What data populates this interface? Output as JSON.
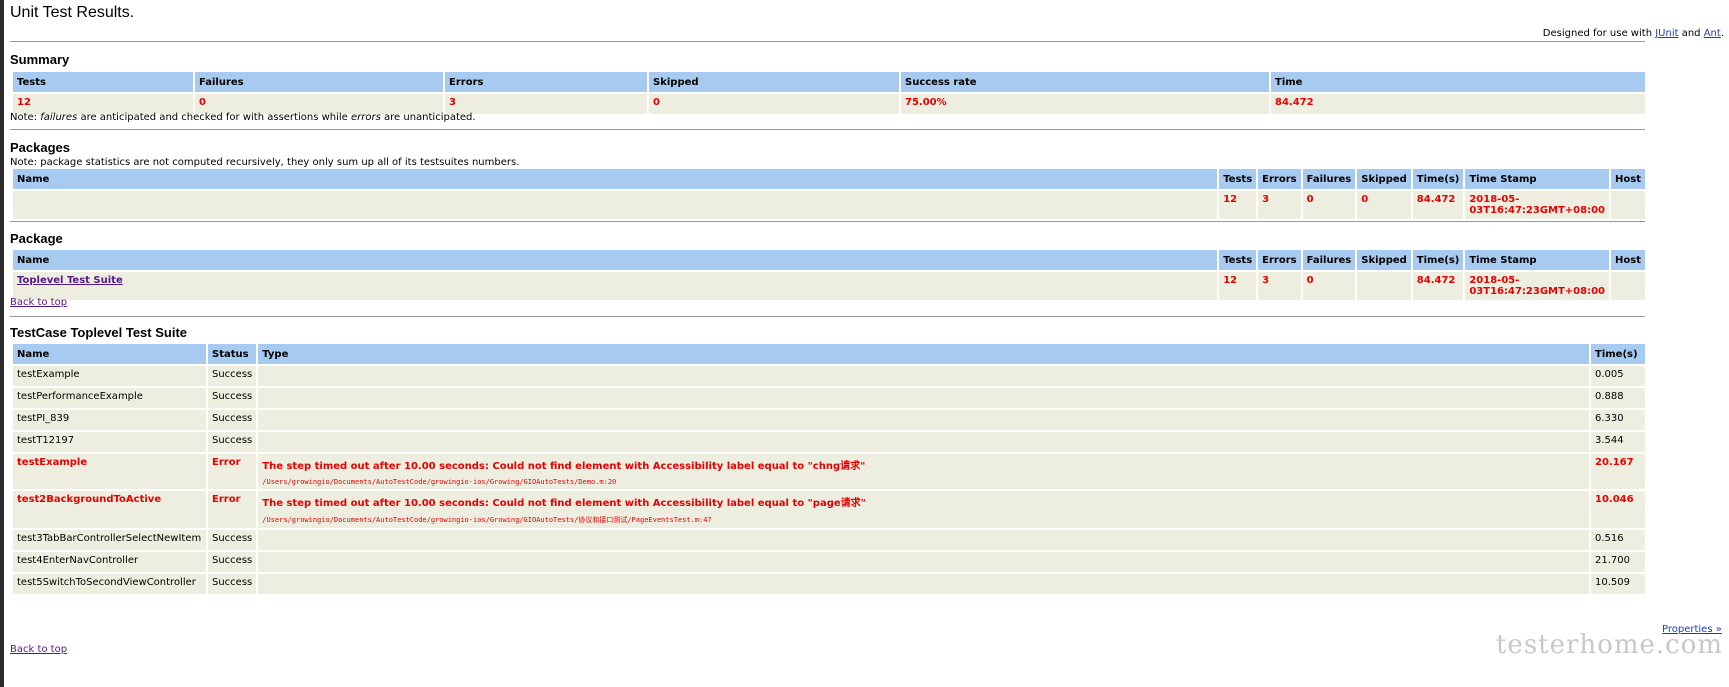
{
  "title": "Unit Test Results.",
  "designed": {
    "prefix": "Designed for use with ",
    "junit": "JUnit",
    "and": " and ",
    "ant": "Ant",
    "suffix": "."
  },
  "summary": {
    "heading": "Summary",
    "headers": [
      "Tests",
      "Failures",
      "Errors",
      "Skipped",
      "Success rate",
      "Time"
    ],
    "values": [
      "12",
      "0",
      "3",
      "0",
      "75.00%",
      "84.472"
    ],
    "note_prefix": "Note: ",
    "note_failures": "failures",
    "note_mid": " are anticipated and checked for with assertions while ",
    "note_errors": "errors",
    "note_suffix": " are unanticipated."
  },
  "packages": {
    "heading": "Packages",
    "note": "Note: package statistics are not computed recursively, they only sum up all of its testsuites numbers.",
    "headers": [
      "Name",
      "Tests",
      "Errors",
      "Failures",
      "Skipped",
      "Time(s)",
      "Time Stamp",
      "Host"
    ],
    "row": [
      "",
      "12",
      "3",
      "0",
      "0",
      "84.472",
      "2018-05-03T16:47:23GMT+08:00",
      ""
    ]
  },
  "package": {
    "heading": "Package",
    "headers": [
      "Name",
      "Tests",
      "Errors",
      "Failures",
      "Skipped",
      "Time(s)",
      "Time Stamp",
      "Host"
    ],
    "row": [
      "Toplevel Test Suite",
      "12",
      "3",
      "0",
      "",
      "84.472",
      "2018-05-03T16:47:23GMT+08:00",
      ""
    ],
    "back_to_top": "Back to top"
  },
  "testcase": {
    "heading": "TestCase Toplevel Test Suite",
    "headers": [
      "Name",
      "Status",
      "Type",
      "Time(s)"
    ],
    "rows": [
      {
        "name": "testExample",
        "status": "Success",
        "type": "",
        "trace": "",
        "time": "0.005"
      },
      {
        "name": "testPerformanceExample",
        "status": "Success",
        "type": "",
        "trace": "",
        "time": "0.888"
      },
      {
        "name": "testPI_839",
        "status": "Success",
        "type": "",
        "trace": "",
        "time": "6.330"
      },
      {
        "name": "testT12197",
        "status": "Success",
        "type": "",
        "trace": "",
        "time": "3.544"
      },
      {
        "name": "testExample",
        "status": "Error",
        "type": "The step timed out after 10.00 seconds: Could not find element with Accessibility label equal to \"chng请求\"",
        "trace": "/Users/growingio/Documents/AutoTestCode/growingio-ios/Growing/GIOAutoTests/Demo.m:20",
        "time": "20.167"
      },
      {
        "name": "test2BackgroundToActive",
        "status": "Error",
        "type": "The step timed out after 10.00 seconds: Could not find element with Accessibility label equal to \"page请求\"",
        "trace": "/Users/growingio/Documents/AutoTestCode/growingio-ios/Growing/GIOAutoTests/协议和接口测试/PageEventsTest.m:47",
        "time": "10.046"
      },
      {
        "name": "test3TabBarControllerSelectNewItem",
        "status": "Success",
        "type": "",
        "trace": "",
        "time": "0.516"
      },
      {
        "name": "test4EnterNavController",
        "status": "Success",
        "type": "",
        "trace": "",
        "time": "21.700"
      },
      {
        "name": "test5SwitchToSecondViewController",
        "status": "Success",
        "type": "",
        "trace": "",
        "time": "10.509"
      }
    ],
    "properties": "Properties »",
    "back_to_top": "Back to top"
  },
  "watermark": "testerhome.com"
}
